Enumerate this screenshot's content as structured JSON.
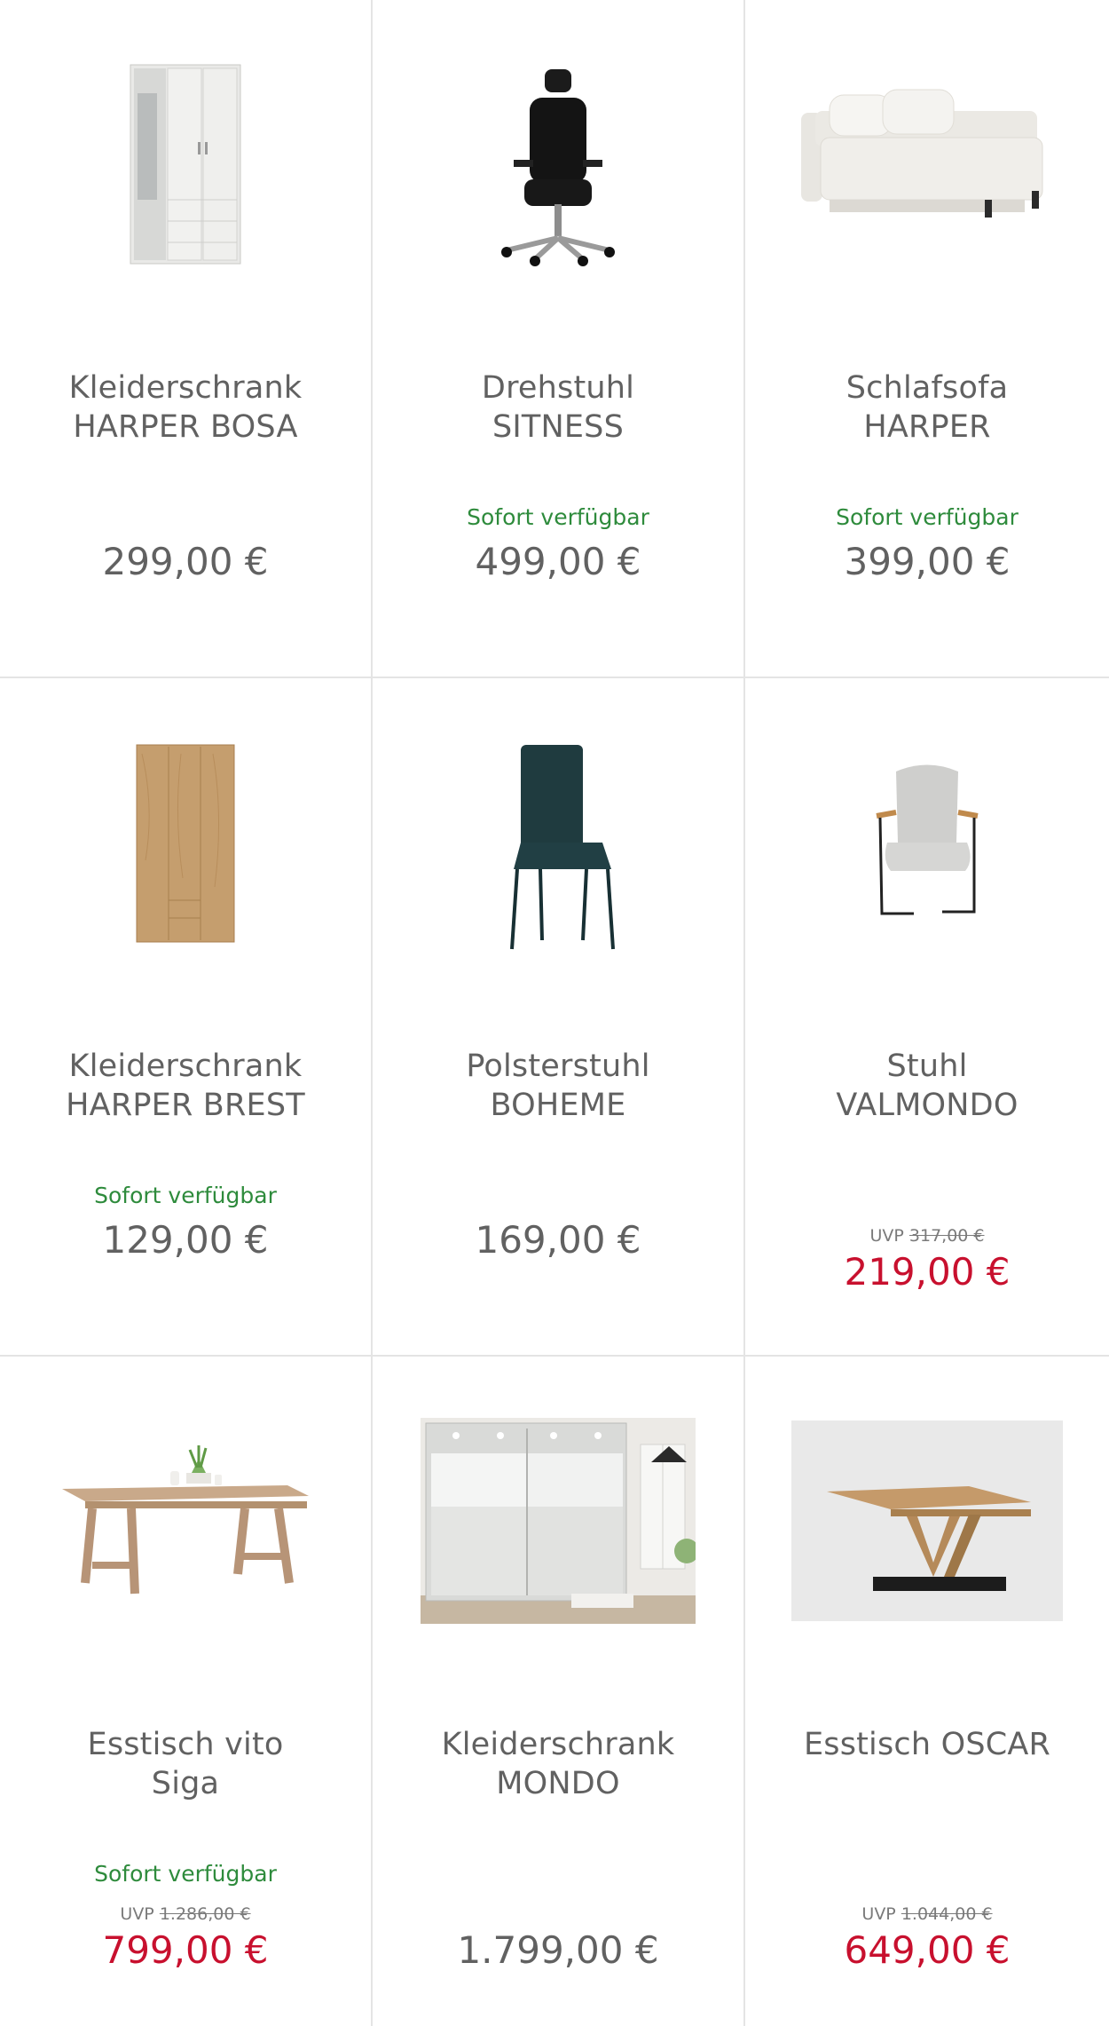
{
  "products": [
    {
      "name_line1": "Kleiderschrank",
      "name_line2": "HARPER BOSA",
      "availability": "",
      "uvp_label": "",
      "uvp_price": "",
      "price": "299,00 €",
      "on_sale": false,
      "image_icon": "wardrobe-mirror-icon"
    },
    {
      "name_line1": "Drehstuhl",
      "name_line2": "SITNESS",
      "availability": "Sofort verfügbar",
      "uvp_label": "",
      "uvp_price": "",
      "price": "499,00 €",
      "on_sale": false,
      "image_icon": "office-chair-icon"
    },
    {
      "name_line1": "Schlafsofa",
      "name_line2": "HARPER",
      "availability": "Sofort verfügbar",
      "uvp_label": "",
      "uvp_price": "",
      "price": "399,00 €",
      "on_sale": false,
      "image_icon": "sofa-bed-icon"
    },
    {
      "name_line1": "Kleiderschrank",
      "name_line2": "HARPER BREST",
      "availability": "Sofort verfügbar",
      "uvp_label": "",
      "uvp_price": "",
      "price": "129,00 €",
      "on_sale": false,
      "image_icon": "wardrobe-oak-icon"
    },
    {
      "name_line1": "Polsterstuhl",
      "name_line2": "BOHEME",
      "availability": "",
      "uvp_label": "",
      "uvp_price": "",
      "price": "169,00 €",
      "on_sale": false,
      "image_icon": "dining-chair-icon"
    },
    {
      "name_line1": "Stuhl",
      "name_line2": "VALMONDO",
      "availability": "",
      "uvp_label": "UVP",
      "uvp_price": "317,00 €",
      "price": "219,00 €",
      "on_sale": true,
      "image_icon": "armchair-icon"
    },
    {
      "name_line1": "Esstisch vito",
      "name_line2": "Siga",
      "availability": "Sofort verfügbar",
      "uvp_label": "UVP",
      "uvp_price": "1.286,00 €",
      "price": "799,00 €",
      "on_sale": true,
      "image_icon": "dining-table-icon"
    },
    {
      "name_line1": "Kleiderschrank",
      "name_line2": "MONDO",
      "availability": "",
      "uvp_label": "",
      "uvp_price": "",
      "price": "1.799,00 €",
      "on_sale": false,
      "image_icon": "sliding-wardrobe-icon"
    },
    {
      "name_line1": "Esstisch OSCAR",
      "name_line2": "",
      "availability": "",
      "uvp_label": "UVP",
      "uvp_price": "1.044,00 €",
      "price": "649,00 €",
      "on_sale": true,
      "image_icon": "extendable-table-icon"
    }
  ],
  "colors": {
    "availability": "#2e8b3c",
    "sale_price": "#c8102e",
    "price": "#616161",
    "divider": "#e4e4e4"
  }
}
